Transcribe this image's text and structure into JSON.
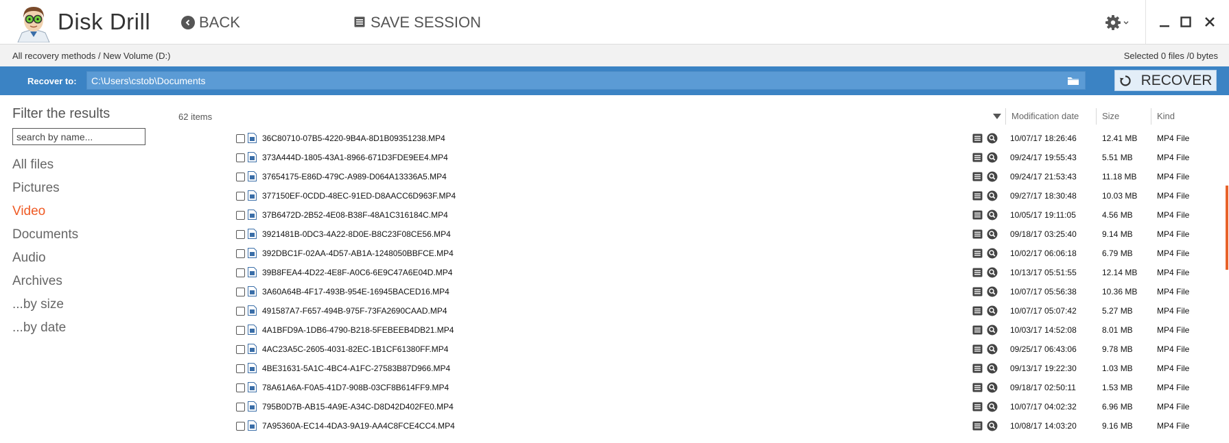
{
  "app": {
    "title": "Disk Drill"
  },
  "toolbar": {
    "back_label": "BACK",
    "save_label": "SAVE SESSION"
  },
  "breadcrumb": "All recovery methods / New Volume (D:)",
  "selection_info": "Selected 0 files /0 bytes",
  "recover_bar": {
    "label": "Recover to:",
    "path": "C:\\Users\\cstob\\Documents",
    "button_label": "RECOVER"
  },
  "sidebar": {
    "title": "Filter the results",
    "search_placeholder": "search by name...",
    "items": [
      {
        "label": "All files",
        "active": false
      },
      {
        "label": "Pictures",
        "active": false
      },
      {
        "label": "Video",
        "active": true
      },
      {
        "label": "Documents",
        "active": false
      },
      {
        "label": "Audio",
        "active": false
      },
      {
        "label": "Archives",
        "active": false
      },
      {
        "label": "...by size",
        "active": false
      },
      {
        "label": "...by date",
        "active": false
      }
    ]
  },
  "list": {
    "count": "62 items",
    "columns": {
      "date": "Modification date",
      "size": "Size",
      "kind": "Kind"
    },
    "rows": [
      {
        "name": "36C80710-07B5-4220-9B4A-8D1B09351238.MP4",
        "date": "10/07/17 18:26:46",
        "size": "12.41 MB",
        "kind": "MP4 File"
      },
      {
        "name": "373A444D-1805-43A1-8966-671D3FDE9EE4.MP4",
        "date": "09/24/17 19:55:43",
        "size": "5.51 MB",
        "kind": "MP4 File"
      },
      {
        "name": "37654175-E86D-479C-A989-D064A13336A5.MP4",
        "date": "09/24/17 21:53:43",
        "size": "11.18 MB",
        "kind": "MP4 File"
      },
      {
        "name": "377150EF-0CDD-48EC-91ED-D8AACC6D963F.MP4",
        "date": "09/27/17 18:30:48",
        "size": "10.03 MB",
        "kind": "MP4 File"
      },
      {
        "name": "37B6472D-2B52-4E08-B38F-48A1C316184C.MP4",
        "date": "10/05/17 19:11:05",
        "size": "4.56 MB",
        "kind": "MP4 File"
      },
      {
        "name": "3921481B-0DC3-4A22-8D0E-B8C23F08CE56.MP4",
        "date": "09/18/17 03:25:40",
        "size": "9.14 MB",
        "kind": "MP4 File"
      },
      {
        "name": "392DBC1F-02AA-4D57-AB1A-1248050BBFCE.MP4",
        "date": "10/02/17 06:06:18",
        "size": "6.79 MB",
        "kind": "MP4 File"
      },
      {
        "name": "39B8FEA4-4D22-4E8F-A0C6-6E9C47A6E04D.MP4",
        "date": "10/13/17 05:51:55",
        "size": "12.14 MB",
        "kind": "MP4 File"
      },
      {
        "name": "3A60A64B-4F17-493B-954E-16945BACED16.MP4",
        "date": "10/07/17 05:56:38",
        "size": "10.36 MB",
        "kind": "MP4 File"
      },
      {
        "name": "491587A7-F657-494B-975F-73FA2690CAAD.MP4",
        "date": "10/07/17 05:07:42",
        "size": "5.27 MB",
        "kind": "MP4 File"
      },
      {
        "name": "4A1BFD9A-1DB6-4790-B218-5FEBEEB4DB21.MP4",
        "date": "10/03/17 14:52:08",
        "size": "8.01 MB",
        "kind": "MP4 File"
      },
      {
        "name": "4AC23A5C-2605-4031-82EC-1B1CF61380FF.MP4",
        "date": "09/25/17 06:43:06",
        "size": "9.78 MB",
        "kind": "MP4 File"
      },
      {
        "name": "4BE31631-5A1C-4BC4-A1FC-27583B87D966.MP4",
        "date": "09/13/17 19:22:30",
        "size": "1.03 MB",
        "kind": "MP4 File"
      },
      {
        "name": "78A61A6A-F0A5-41D7-908B-03CF8B614FF9.MP4",
        "date": "09/18/17 02:50:11",
        "size": "1.53 MB",
        "kind": "MP4 File"
      },
      {
        "name": "795B0D7B-AB15-4A9E-A34C-D8D42D402FE0.MP4",
        "date": "10/07/17 04:02:32",
        "size": "6.96 MB",
        "kind": "MP4 File"
      },
      {
        "name": "7A95360A-EC14-4DA3-9A19-AA4C8FCE4CC4.MP4",
        "date": "10/08/17 14:03:20",
        "size": "9.16 MB",
        "kind": "MP4 File"
      }
    ]
  },
  "colors": {
    "accent_blue": "#3b83c4",
    "active_orange": "#ef5a24"
  },
  "icons": {
    "logo": "disk-drill-mascot",
    "back": "back-arrow-circle-icon",
    "save": "list-icon",
    "settings": "gear-icon",
    "minimize": "minimize-icon",
    "maximize": "maximize-icon",
    "close": "close-icon",
    "folder": "folder-icon",
    "recover": "refresh-icon",
    "file": "video-file-icon",
    "preview": "preview-icon",
    "search": "search-icon"
  }
}
